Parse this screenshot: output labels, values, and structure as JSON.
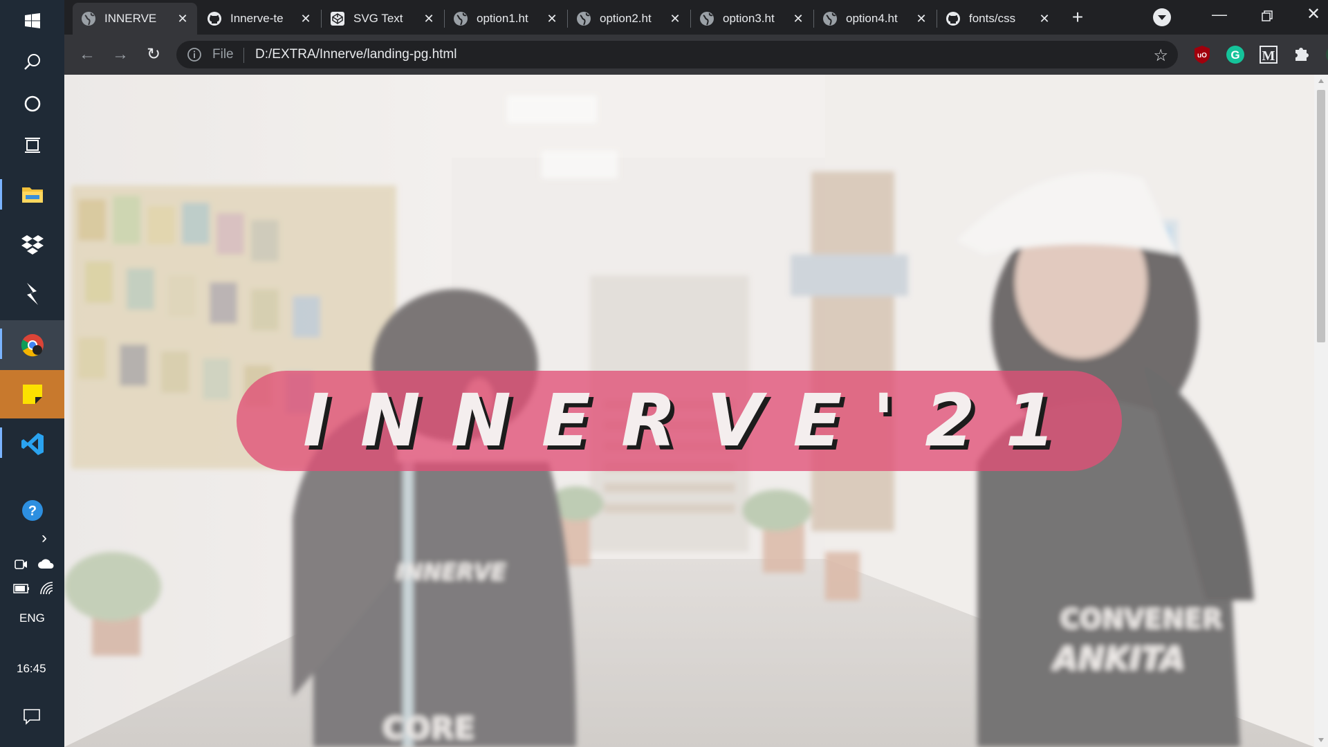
{
  "taskbar": {
    "items": [
      {
        "name": "start",
        "icon": "windows-icon"
      },
      {
        "name": "search",
        "icon": "search-icon"
      },
      {
        "name": "cortana",
        "icon": "cortana-icon"
      },
      {
        "name": "task-view",
        "icon": "task-view-icon"
      },
      {
        "name": "file-explorer",
        "icon": "folder-icon"
      },
      {
        "name": "dropbox",
        "icon": "dropbox-icon"
      },
      {
        "name": "app",
        "icon": "app-icon"
      },
      {
        "name": "chrome",
        "icon": "chrome-icon"
      },
      {
        "name": "sticky-notes",
        "icon": "sticky-notes-icon"
      },
      {
        "name": "vscode",
        "icon": "vscode-icon"
      },
      {
        "name": "help",
        "icon": "help-icon"
      }
    ],
    "tray_expand": "›",
    "language": "ENG",
    "time": "16:45"
  },
  "tabs": [
    {
      "label": "INNERVE",
      "icon": "globe-icon",
      "active": true
    },
    {
      "label": "Innerve-te",
      "icon": "github-icon"
    },
    {
      "label": "SVG Text",
      "icon": "codepen-icon"
    },
    {
      "label": "option1.ht",
      "icon": "globe-icon"
    },
    {
      "label": "option2.ht",
      "icon": "globe-icon"
    },
    {
      "label": "option3.ht",
      "icon": "globe-icon"
    },
    {
      "label": "option4.ht",
      "icon": "globe-icon"
    },
    {
      "label": "fonts/css",
      "icon": "github-icon"
    }
  ],
  "toolbar": {
    "omnibox_scheme": "File",
    "omnibox_url": "D:/EXTRA/Innerve/landing-pg.html"
  },
  "page": {
    "banner_title": "INNERVE'21",
    "background_image": "hallway-video-still"
  },
  "colors": {
    "banner": "#e05076",
    "chrome_dark": "#202124",
    "chrome_toolbar": "#35363a",
    "taskbar": "#1f2a36"
  }
}
